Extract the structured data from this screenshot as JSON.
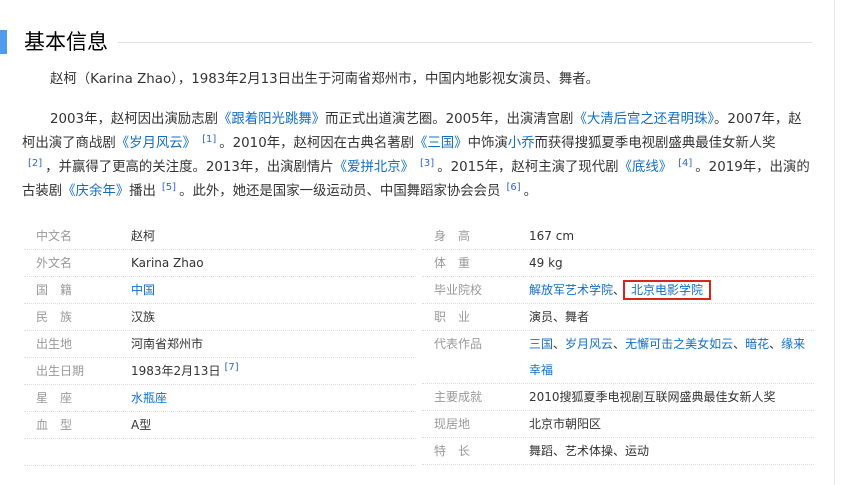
{
  "section": {
    "title": "基本信息"
  },
  "intro": {
    "p1": "赵柯（Karina Zhao），1983年2月13日出生于河南省郑州市，中国内地影视女演员、舞者。",
    "p2": {
      "t1": "2003年，赵柯因出演励志剧",
      "l1": "《跟着阳光跳舞》",
      "t2": "而正式出道演艺圈。2005年，出演清宫剧",
      "l2": "《大清后宫之还君明珠》",
      "t3": "。2007年，赵柯出演了商战剧",
      "l3": "《岁月风云》",
      "r1": "[1]",
      "t4": "。2010年，赵柯因在古典名著剧",
      "l4": "《三国》",
      "t5": "中饰演",
      "l5": "小乔",
      "t6": "而获得搜狐夏季电视剧盛典最佳女新人奖",
      "r2": "[2]",
      "t7": "，并赢得了更高的关注度。2013年，出演剧情片",
      "l6": "《爱拼北京》",
      "r3": "[3]",
      "t8": "。2015年，赵柯主演了现代剧",
      "l7": "《底线》",
      "r4": "[4]",
      "t9": "。2019年，出演的古装剧",
      "l8": "《庆余年》",
      "t10": "播出",
      "r5": "[5]",
      "t11": "。此外，她还是国家一级运动员、中国舞蹈家协会会员",
      "r6": "[6]",
      "t12": "。"
    }
  },
  "info_left": {
    "chinese_name": {
      "label": "中文名",
      "value": "赵柯"
    },
    "foreign_name": {
      "label": "外文名",
      "value": "Karina Zhao"
    },
    "nationality": {
      "label": "国　籍",
      "value": "中国"
    },
    "ethnicity": {
      "label": "民　族",
      "value": "汉族"
    },
    "birthplace": {
      "label": "出生地",
      "value": "河南省郑州市"
    },
    "birthdate": {
      "label": "出生日期",
      "value": "1983年2月13日",
      "ref": "[7]"
    },
    "zodiac": {
      "label": "星　座",
      "value": "水瓶座"
    },
    "blood_type": {
      "label": "血　型",
      "value": "A型"
    }
  },
  "info_right": {
    "height": {
      "label": "身　高",
      "value": "167 cm"
    },
    "weight": {
      "label": "体　重",
      "value": "49 kg"
    },
    "school": {
      "label": "毕业院校",
      "value1": "解放军艺术学院",
      "value2": "北京电影学院"
    },
    "occupation": {
      "label": "职　业",
      "value": "演员、舞者"
    },
    "works": {
      "label": "代表作品",
      "w1": "三国",
      "w2": "岁月风云",
      "w3": "无懈可击之美女如云",
      "w4": "暗花",
      "w5": "缘来幸福"
    },
    "achievement": {
      "label": "主要成就",
      "value": "2010搜狐夏季电视剧互联网盛典最佳女新人奖"
    },
    "residence": {
      "label": "现居地",
      "value": "北京市朝阳区"
    },
    "specialty": {
      "label": "特　长",
      "value": "舞蹈、艺术体操、运动"
    }
  }
}
